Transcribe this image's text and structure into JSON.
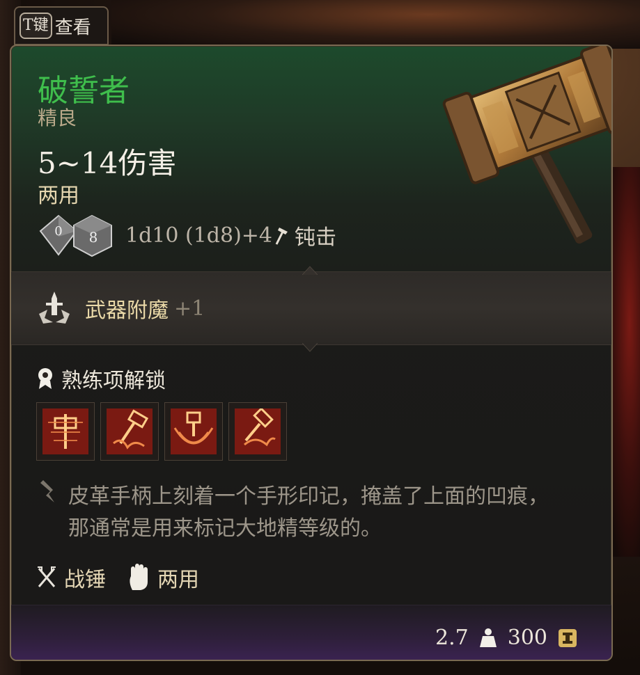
{
  "view_button": {
    "key": "T键",
    "label": "查看"
  },
  "item": {
    "name": "破誓者",
    "rarity": "精良",
    "damage": "5~14伤害",
    "handedness": "两用",
    "dice": {
      "die1": "0",
      "die2": "8"
    },
    "formula": "1d10 (1d8)+4",
    "damage_type": "钝击",
    "icon": "warhammer-icon"
  },
  "enchant": {
    "label": "武器附魔",
    "value": "+1"
  },
  "proficiency": {
    "header": "熟练项解锁",
    "icons": [
      "proficiency-action-1-icon",
      "proficiency-action-2-icon",
      "proficiency-action-3-icon",
      "proficiency-action-4-icon"
    ]
  },
  "description": {
    "line1": "皮革手柄上刻着一个手形印记，掩盖了上面的凹痕，",
    "line2": "那通常是用来标记大地精等级的。"
  },
  "types": {
    "weapon_type": "战锤",
    "hand_type": "两用"
  },
  "stats": {
    "weight": "2.7",
    "value": "300"
  },
  "colors": {
    "name": "#3fbe4c",
    "rarity": "#b9a98a",
    "accent": "#ead9a8"
  }
}
